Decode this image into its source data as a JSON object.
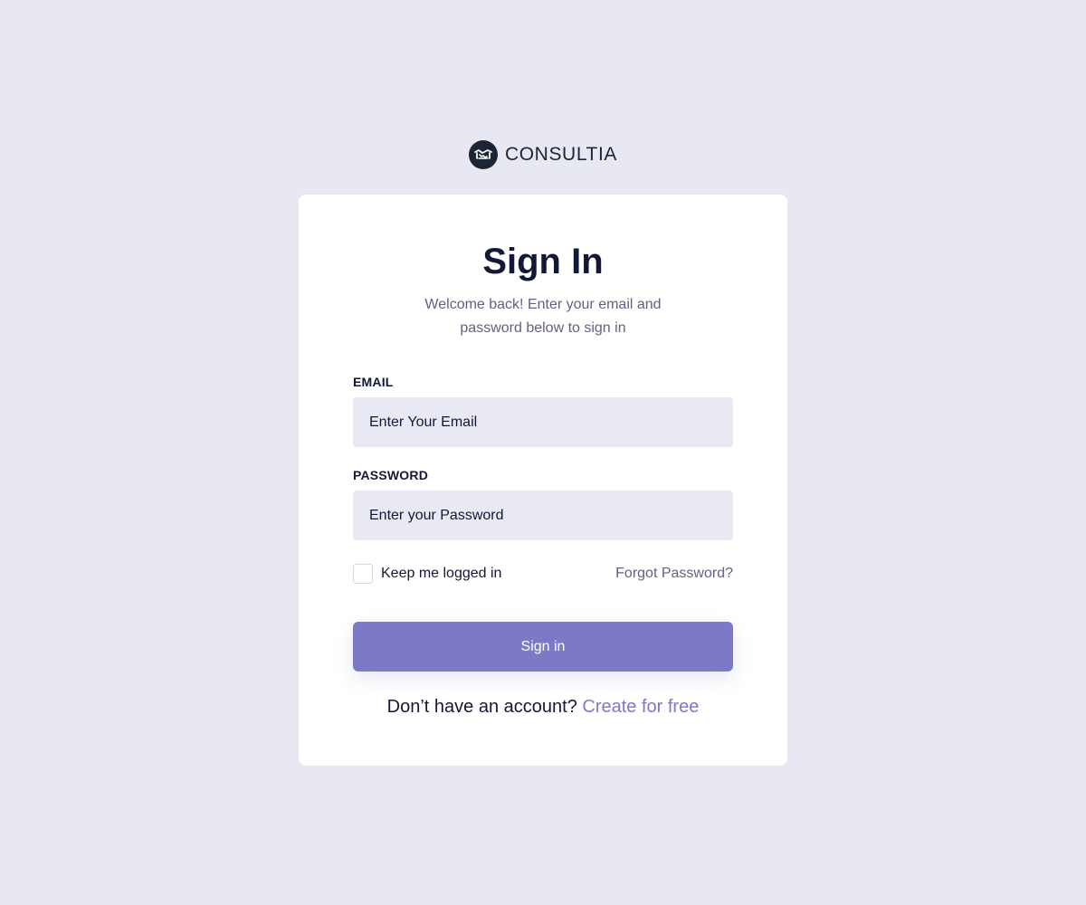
{
  "brand": {
    "name": "CONSULTIA",
    "logo_icon": "handshake-icon"
  },
  "signin": {
    "title": "Sign In",
    "subtitle_line1": "Welcome back! Enter your email and",
    "subtitle_line2": "password below to sign in",
    "email_label": "EMAIL",
    "email_placeholder": "Enter Your Email",
    "email_value": "",
    "password_label": "PASSWORD",
    "password_placeholder": "Enter your Password",
    "password_value": "",
    "remember_label": "Keep me logged in",
    "remember_checked": false,
    "forgot_label": "Forgot Password?",
    "button_label": "Sign in",
    "no_account_text": "Don’t have an account?",
    "create_link_label": "Create for free"
  },
  "colors": {
    "page_background": "#e8e8f3",
    "card_background": "#ffffff",
    "input_background": "#e9e9f4",
    "accent": "#7c7ac6",
    "heading": "#141838",
    "muted_text": "#5f6380",
    "logo_background": "#1d2433"
  }
}
